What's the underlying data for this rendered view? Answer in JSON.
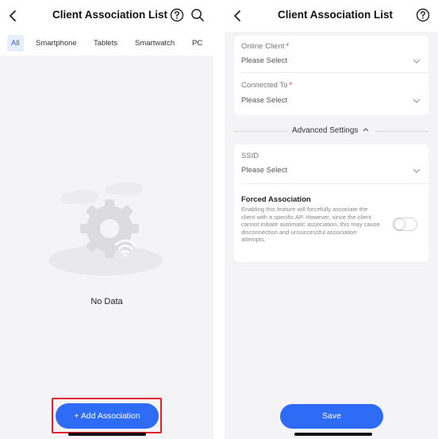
{
  "left": {
    "title": "Client Association List",
    "tabs": [
      {
        "label": "All",
        "active": true
      },
      {
        "label": "Smartphone",
        "active": false
      },
      {
        "label": "Tablets",
        "active": false
      },
      {
        "label": "Smartwatch",
        "active": false
      },
      {
        "label": "PC",
        "active": false
      }
    ],
    "empty_text": "No Data",
    "add_button": "+ Add Association"
  },
  "right": {
    "title": "Client Association List",
    "online_client": {
      "label": "Online Client",
      "required_mark": "*",
      "value": "Please Select"
    },
    "connected_to": {
      "label": "Connected To",
      "required_mark": "*",
      "value": "Please Select"
    },
    "advanced_label": "Advanced Settings",
    "ssid": {
      "label": "SSID",
      "value": "Please Select"
    },
    "forced_association": {
      "title": "Forced Association",
      "description": "Enabling this feature will forcefully associate the client with a specific AP. However, since the client cannot initiate automatic association, this may cause disconnection and unsuccessful association attempts.",
      "enabled": false
    },
    "save_button": "Save"
  },
  "icons": [
    "back-arrow-icon",
    "help-icon",
    "search-icon",
    "chevron-down-icon",
    "chevron-up-icon",
    "empty-state-illustration"
  ],
  "colors": {
    "accent": "#2f6cf5",
    "highlight_border": "#e0202a",
    "required": "#e03030",
    "background": "#f4f4f6"
  }
}
